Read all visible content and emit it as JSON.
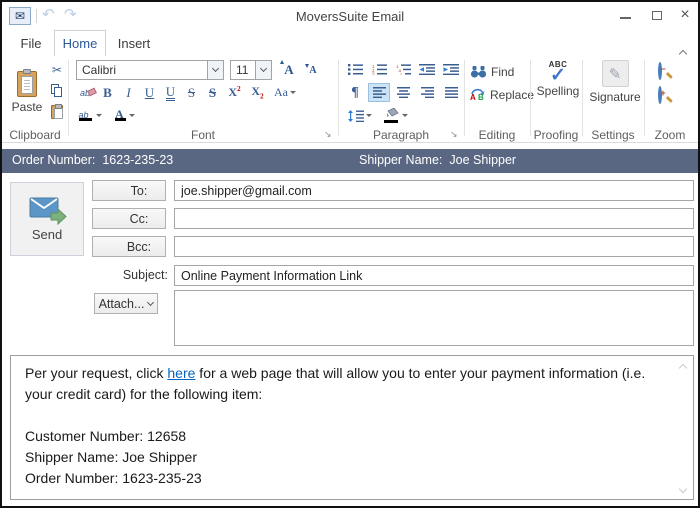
{
  "window": {
    "title": "MoversSuite Email"
  },
  "glyphs": {
    "mail": "✉",
    "undo": "↶",
    "redo": "↷",
    "close": "×",
    "scissors": "✂",
    "pilcrow": "¶",
    "check": "✓",
    "pen": "✎",
    "launcher": "↘",
    "minus": "−",
    "plus": "+"
  },
  "tabs": {
    "file": "File",
    "home": "Home",
    "insert": "Insert",
    "active": "Home"
  },
  "ribbon": {
    "clipboard": {
      "label": "Clipboard",
      "paste_label": "Paste"
    },
    "font": {
      "label": "Font",
      "name": "Calibri",
      "size": "11",
      "grow": "A",
      "shrink": "A",
      "clear": "ab",
      "bold": "B",
      "italic": "I",
      "underline": "U",
      "double_underline": "U",
      "strike": "S",
      "double_strike": "S",
      "sup_base": "X",
      "sup_mark": "2",
      "sub_base": "X",
      "sub_mark": "2",
      "change_case": "Aa",
      "highlight": "ab",
      "font_color": "A"
    },
    "paragraph": {
      "label": "Paragraph"
    },
    "editing": {
      "label": "Editing",
      "find": "Find",
      "replace": "Replace",
      "replace_a": "A",
      "replace_b": "B"
    },
    "proofing": {
      "label": "Proofing",
      "abc": "ABC",
      "spelling": "Spelling"
    },
    "settings": {
      "label": "Settings",
      "signature": "Signature"
    },
    "zoom": {
      "label": "Zoom"
    }
  },
  "info_bar": {
    "order_label": "Order Number:",
    "order_value": "1623-235-23",
    "shipper_label": "Shipper Name:",
    "shipper_value": "Joe Shipper",
    "bg_color": "#5a6783"
  },
  "form": {
    "send_label": "Send",
    "to_label": "To:",
    "to_value": "joe.shipper@gmail.com",
    "cc_label": "Cc:",
    "cc_value": "",
    "bcc_label": "Bcc:",
    "bcc_value": "",
    "subject_label": "Subject:",
    "subject_value": "Online Payment Information Link",
    "attach_label": "Attach..."
  },
  "body": {
    "intro_before_link": "Per your request, click ",
    "link_text": "here",
    "intro_after_link": " for a web page that will allow you to enter your payment information (i.e. your credit card) for the following item:",
    "details": [
      "Customer Number: 12658",
      "Shipper Name: Joe Shipper",
      "Order Number: 1623-235-23"
    ]
  },
  "colors": {
    "accent_blue": "#2b579a",
    "icon_blue": "#3b5e91",
    "link": "#0563c1"
  }
}
